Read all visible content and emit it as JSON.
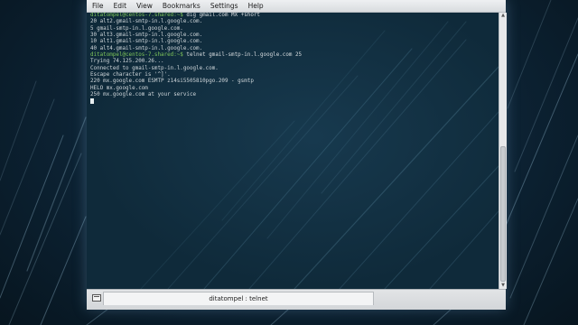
{
  "menu": [
    "File",
    "Edit",
    "View",
    "Bookmarks",
    "Settings",
    "Help"
  ],
  "terminal": {
    "lines": [
      {
        "prompt": "ditatompel@centos-7.shared:~$ ",
        "text": "dig gmail.com MX +short"
      },
      {
        "prompt": "",
        "text": "20 alt2.gmail-smtp-in.l.google.com."
      },
      {
        "prompt": "",
        "text": "5 gmail-smtp-in.l.google.com."
      },
      {
        "prompt": "",
        "text": "30 alt3.gmail-smtp-in.l.google.com."
      },
      {
        "prompt": "",
        "text": "10 alt1.gmail-smtp-in.l.google.com."
      },
      {
        "prompt": "",
        "text": "40 alt4.gmail-smtp-in.l.google.com."
      },
      {
        "prompt": "ditatompel@centos-7.shared:~$ ",
        "text": "telnet gmail-smtp-in.l.google.com 25"
      },
      {
        "prompt": "",
        "text": "Trying 74.125.200.26..."
      },
      {
        "prompt": "",
        "text": "Connected to gmail-smtp-in.l.google.com."
      },
      {
        "prompt": "",
        "text": "Escape character is '^]'."
      },
      {
        "prompt": "",
        "text": "220 mx.google.com ESMTP z14si5505810pgo.209 - gsmtp"
      },
      {
        "prompt": "",
        "text": "HELO mx.google.com"
      },
      {
        "prompt": "",
        "text": "250 mx.google.com at your service"
      }
    ]
  },
  "tab": {
    "title": "ditatompel : telnet"
  },
  "colors": {
    "prompt": "#7fc65a",
    "text": "#cfd6da",
    "terminal_bg": "#0f2a3a"
  }
}
